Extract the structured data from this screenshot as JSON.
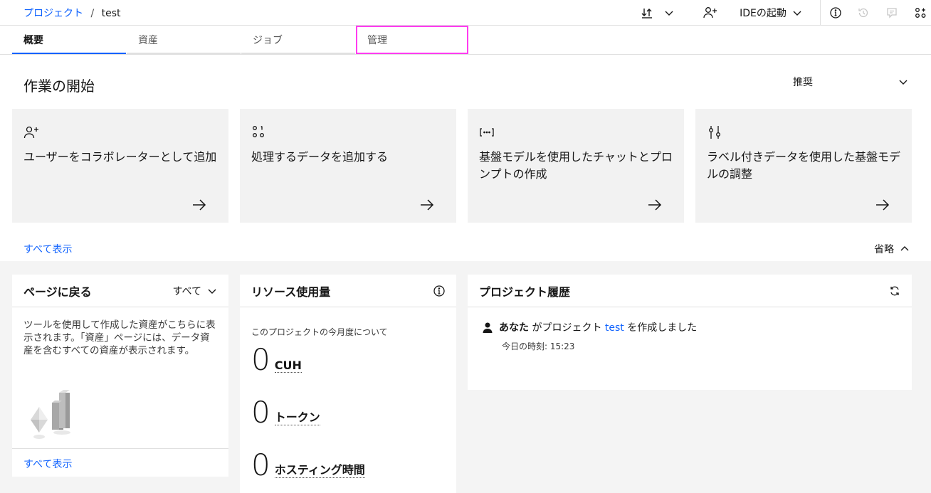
{
  "breadcrumb": {
    "root": "プロジェクト",
    "separator": "/",
    "current": "test"
  },
  "toolbar": {
    "ide_label": "IDEの起動"
  },
  "tabs": [
    {
      "label": "概要"
    },
    {
      "label": "資産"
    },
    {
      "label": "ジョブ"
    },
    {
      "label": "管理"
    }
  ],
  "getting_started": {
    "title": "作業の開始",
    "recommend_label": "推奨",
    "cards": [
      {
        "text": "ユーザーをコラボレーターとして追加",
        "icon": "add-user-icon"
      },
      {
        "text": "処理するデータを追加する",
        "icon": "data-icon"
      },
      {
        "text": "基盤モデルを使用したチャットとプロンプトの作成",
        "icon": "prompt-icon"
      },
      {
        "text": "ラベル付きデータを使用した基盤モデルの調整",
        "icon": "tuning-icon"
      }
    ],
    "show_all": "すべて表示",
    "collapse_label": "省略"
  },
  "return_panel": {
    "title": "ページに戻る",
    "filter_label": "すべて",
    "description": "ツールを使用して作成した資産がこちらに表示されます。「資産」ページには、データ資産を含むすべての資産が表示されます。",
    "show_all": "すべて表示"
  },
  "resource_panel": {
    "title": "リソース使用量",
    "subtitle": "このプロジェクトの今月度について",
    "rows": [
      {
        "value": "0",
        "unit": "CUH"
      },
      {
        "value": "0",
        "unit": "トークン"
      },
      {
        "value": "0",
        "unit": "ホスティング時間"
      }
    ]
  },
  "history_panel": {
    "title": "プロジェクト履歴",
    "actor": "あなた",
    "text_before": "がプロジェクト",
    "project_link": "test",
    "text_after": "を作成しました",
    "time": "今日の時刻: 15:23"
  }
}
